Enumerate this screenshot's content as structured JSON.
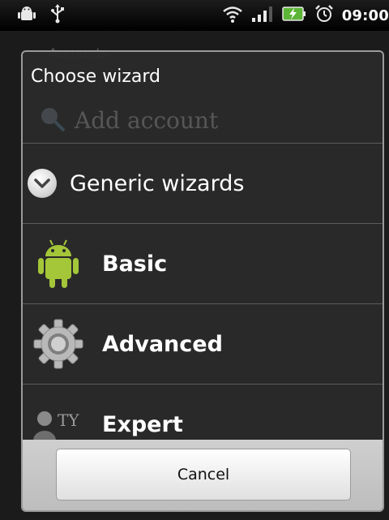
{
  "status_bar": {
    "time": "09:00",
    "left_icons": [
      "android-notification-icon",
      "usb-icon"
    ],
    "right_icons": [
      "wifi-icon",
      "signal-icon",
      "battery-charging-icon",
      "alarm-icon"
    ]
  },
  "background_app": {
    "header": "Accounts",
    "add_account_label": "Add account"
  },
  "dialog": {
    "title": "Choose wizard",
    "group": {
      "label": "Generic wizards",
      "icon": "chevron-down-circle-icon"
    },
    "items": [
      {
        "label": "Basic",
        "icon": "android-robot-icon"
      },
      {
        "label": "Advanced",
        "icon": "gear-icon"
      },
      {
        "label": "Expert",
        "icon": "expert-user-icon"
      }
    ],
    "cancel_label": "Cancel"
  },
  "colors": {
    "dialog_background": "#2a2a2a",
    "android_green": "#a4c639",
    "button_bar": "#c8c8c8"
  }
}
